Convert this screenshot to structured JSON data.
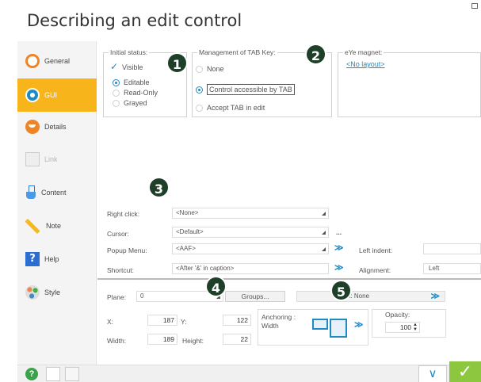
{
  "window": {
    "title": "Describing an edit control"
  },
  "sidebar": {
    "items": [
      {
        "label": "General",
        "icon": "general-icon"
      },
      {
        "label": "GUI",
        "icon": "gui-icon",
        "active": true
      },
      {
        "label": "Details",
        "icon": "details-icon"
      },
      {
        "label": "Link",
        "icon": "link-icon",
        "disabled": true
      },
      {
        "label": "Content",
        "icon": "content-icon"
      },
      {
        "label": "Note",
        "icon": "note-icon"
      },
      {
        "label": "Help",
        "icon": "help-icon"
      },
      {
        "label": "Style",
        "icon": "style-icon"
      }
    ]
  },
  "initial_status": {
    "title": "Initial status:",
    "visible_label": "Visible",
    "visible_checked": true,
    "options": [
      "Editable",
      "Read-Only",
      "Grayed"
    ],
    "selected": "Editable"
  },
  "tab_key": {
    "title": "Management of TAB Key:",
    "options": [
      "None",
      "Control accessible by TAB",
      "Accept TAB in edit"
    ],
    "selected": "Control accessible by TAB"
  },
  "magnet": {
    "title": "eYe magnet:",
    "link": "<No layout>"
  },
  "fields": {
    "right_click_label": "Right click:",
    "right_click_value": "<None>",
    "cursor_label": "Cursor:",
    "cursor_value": "<Default>",
    "cursor_more": "...",
    "popup_label": "Popup Menu:",
    "popup_value": "<AAF>",
    "shortcut_label": "Shortcut:",
    "shortcut_value": "<After '&' in caption>",
    "left_indent_label": "Left indent:",
    "left_indent_value": "",
    "alignment_label": "Alignment:",
    "alignment_value": "Left"
  },
  "position": {
    "plane_label": "Plane:",
    "plane_value": "0",
    "groups_button": "Groups...",
    "third_combo": "",
    "max_value": "ax: None",
    "x_label": "X:",
    "x_value": "187",
    "y_label": "Y:",
    "y_value": "122",
    "width_label": "Width:",
    "width_value": "189",
    "height_label": "Height:",
    "height_value": "22",
    "anchoring_label": "Anchoring :",
    "anchoring_value": "Width",
    "opacity_label": "Opacity:",
    "opacity_value": "100"
  },
  "callouts": [
    "1",
    "2",
    "3",
    "4",
    "5"
  ],
  "colors": {
    "accent": "#1e8bc3",
    "active_tab": "#f8b41b",
    "ok_button": "#8dc63f",
    "callout": "#1e3f28"
  }
}
